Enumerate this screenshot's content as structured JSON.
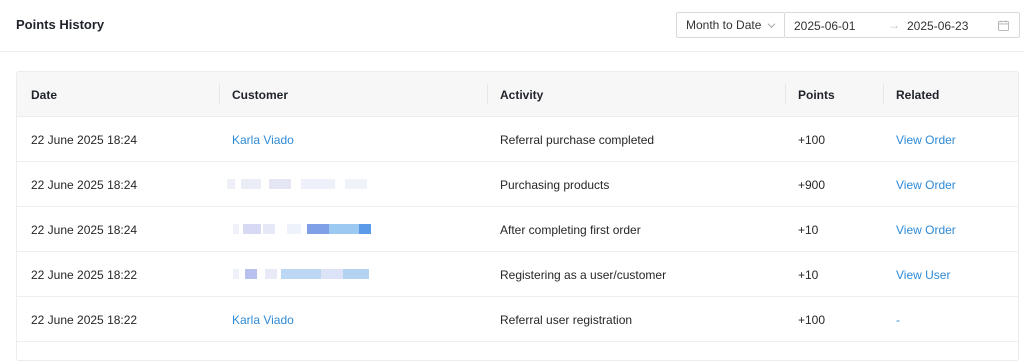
{
  "header": {
    "title": "Points History",
    "period": "Month to Date",
    "date_start": "2025-06-01",
    "date_arrow": "→",
    "date_end": "2025-06-23"
  },
  "table": {
    "columns": [
      "Date",
      "Customer",
      "Activity",
      "Points",
      "Related"
    ],
    "rows": [
      {
        "date": "22 June 2025 18:24",
        "customer": "Karla Viado",
        "activity": "Referral purchase completed",
        "points": "+100",
        "related": "View Order"
      },
      {
        "date": "22 June 2025 18:24",
        "customer": "",
        "activity": "Purchasing products",
        "points": "+900",
        "related": "View Order"
      },
      {
        "date": "22 June 2025 18:24",
        "customer": "",
        "activity": "After completing first order",
        "points": "+10",
        "related": "View Order"
      },
      {
        "date": "22 June 2025 18:22",
        "customer": "",
        "activity": "Registering as a user/customer",
        "points": "+10",
        "related": "View User"
      },
      {
        "date": "22 June 2025 18:22",
        "customer": "Karla Viado",
        "activity": "Referral user registration",
        "points": "+100",
        "related": "-"
      }
    ]
  },
  "colors": {
    "link": "#2f8ad6",
    "header_bg": "#f7f7f7"
  }
}
